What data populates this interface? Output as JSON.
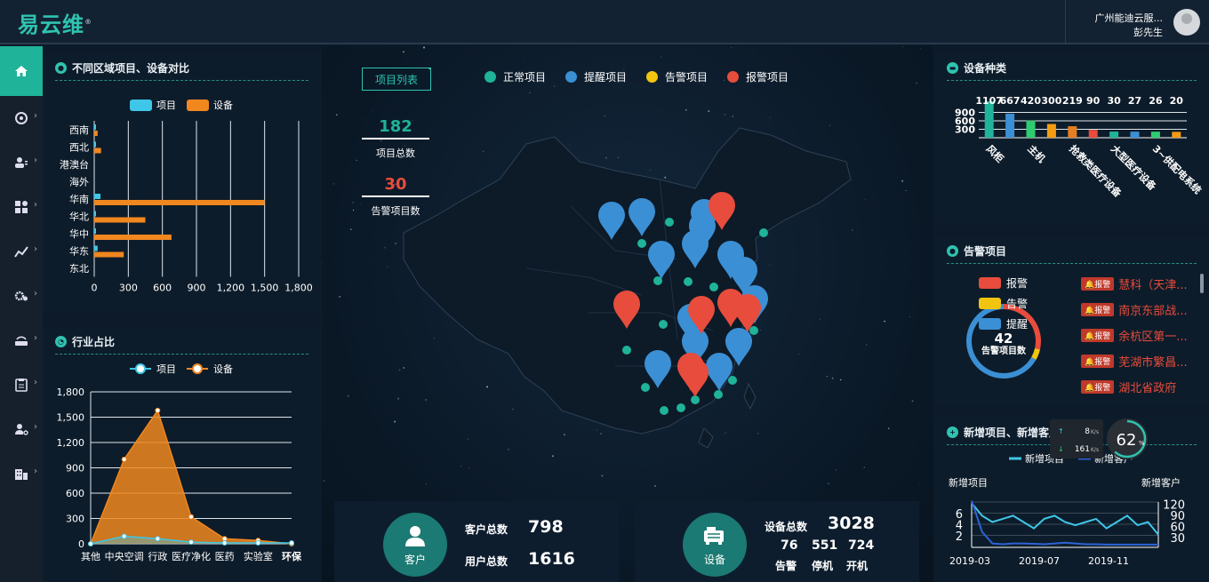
{
  "header": {
    "logo_text": "易云维",
    "logo_mark": "®",
    "company": "广州能迪云服...",
    "user": "彭先生"
  },
  "sidebar": {
    "items": [
      {
        "icon": "home-icon"
      },
      {
        "icon": "dashboard-icon"
      },
      {
        "icon": "users-icon"
      },
      {
        "icon": "grid-icon"
      },
      {
        "icon": "chart-icon"
      },
      {
        "icon": "settings-icon"
      },
      {
        "icon": "router-icon"
      },
      {
        "icon": "clipboard-icon"
      },
      {
        "icon": "user-settings-icon"
      },
      {
        "icon": "building-icon"
      }
    ]
  },
  "region_panel": {
    "title": "不同区域项目、设备对比",
    "legend": [
      "项目",
      "设备"
    ]
  },
  "industry_panel": {
    "title": "行业占比",
    "legend": [
      "项目",
      "设备"
    ]
  },
  "center": {
    "project_list_button": "项目列表",
    "legend": [
      {
        "label": "正常项目",
        "color": "#1fb39a"
      },
      {
        "label": "提醒项目",
        "color": "#3b8fd4"
      },
      {
        "label": "告警项目",
        "color": "#f1c40f"
      },
      {
        "label": "报警项目",
        "color": "#e74c3c"
      }
    ],
    "total_projects": "182",
    "total_projects_label": "项目总数",
    "alarm_projects": "30",
    "alarm_projects_label": "告警项目数"
  },
  "customer_card": {
    "icon_label": "客户",
    "customer_total_label": "客户总数",
    "customer_total": "798",
    "user_total_label": "用户总数",
    "user_total": "1616"
  },
  "device_card": {
    "icon_label": "设备",
    "device_total_label": "设备总数",
    "device_total": "3028",
    "alarm_count": "76",
    "alarm_label": "告警",
    "stopped_count": "551",
    "stopped_label": "停机",
    "running_count": "724",
    "running_label": "开机"
  },
  "device_type_panel": {
    "title": "设备种类"
  },
  "alarm_panel": {
    "title": "告警项目",
    "legend": [
      {
        "label": "报警",
        "color": "#e74c3c"
      },
      {
        "label": "告警",
        "color": "#f1c40f"
      },
      {
        "label": "提醒",
        "color": "#3b8fd4"
      }
    ],
    "center_value": "42",
    "center_label": "告警项目数",
    "badge": "报警",
    "items": [
      "慧科（天津...",
      "南京东部战...",
      "余杭区第一...",
      "芜湖市繁昌...",
      "湖北省政府"
    ]
  },
  "new_panel": {
    "title": "新增项目、新增客户",
    "legend": [
      "新增项目",
      "新增客户"
    ],
    "left_axis_title": "新增项目",
    "right_axis_title": "新增客户"
  },
  "net_widget": {
    "up": "8",
    "down": "161",
    "unit": "K/s",
    "percent": "62",
    "percent_unit": "%"
  },
  "chart_data": [
    {
      "type": "bar",
      "orientation": "horizontal",
      "categories": [
        "西南",
        "西北",
        "港澳台",
        "海外",
        "华南",
        "华北",
        "华中",
        "华东",
        "东北"
      ],
      "series": [
        {
          "name": "项目",
          "values": [
            5,
            5,
            0,
            0,
            55,
            10,
            10,
            30,
            0
          ]
        },
        {
          "name": "设备",
          "values": [
            30,
            60,
            0,
            0,
            1500,
            450,
            680,
            260,
            0
          ]
        }
      ],
      "xlim": [
        0,
        1800
      ],
      "xticks": [
        "0",
        "300",
        "600",
        "900",
        "1,200",
        "1,500",
        "1,800"
      ],
      "colors": [
        "#3ec7e8",
        "#f0871f"
      ]
    },
    {
      "type": "area",
      "categories": [
        "其他",
        "中央空调",
        "行政",
        "医疗净化",
        "医药",
        "实验室",
        "环保"
      ],
      "x_tick_labels": [
        "其他",
        "中央空调",
        "行政",
        "医疗净化",
        "医药",
        "实验室",
        "环保"
      ],
      "series": [
        {
          "name": "项目",
          "values": [
            0,
            90,
            60,
            20,
            10,
            10,
            10
          ]
        },
        {
          "name": "设备",
          "values": [
            0,
            1000,
            1580,
            320,
            60,
            40,
            0
          ]
        }
      ],
      "ylim": [
        0,
        1800
      ],
      "yticks": [
        "0",
        "300",
        "600",
        "900",
        "1,200",
        "1,500",
        "1,800"
      ],
      "colors": [
        "#3ec7e8",
        "#f0871f"
      ]
    },
    {
      "type": "bar",
      "categories": [
        "风柜",
        "",
        "主机",
        "",
        "抢救类医疗设备",
        "",
        "大型医疗设备",
        "",
        "3~供配电系统"
      ],
      "values": [
        1107,
        667,
        420,
        300,
        219,
        90,
        30,
        27,
        26,
        20
      ],
      "value_labels": [
        "1107",
        "667",
        "420",
        "300",
        "219",
        "90",
        "30",
        "27",
        "26",
        "20"
      ],
      "x_tick_labels": [
        "风柜",
        "主机",
        "抢救类医疗设备",
        "大型医疗设备",
        "3~供配电系统"
      ],
      "yticks": [
        "300",
        "600",
        "900"
      ],
      "colors": [
        "#1fb39a",
        "#3b8fd4",
        "#2ecc71",
        "#f39c12",
        "#e67e22",
        "#e74c3c"
      ]
    },
    {
      "type": "pie",
      "labels": [
        "报警",
        "告警",
        "提醒"
      ],
      "values": [
        12,
        2,
        28
      ],
      "colors": [
        "#e74c3c",
        "#f1c40f",
        "#3b8fd4"
      ]
    },
    {
      "type": "line",
      "x_tick_labels": [
        "2019-03",
        "2019-07",
        "2019-11"
      ],
      "left_yticks": [
        "2",
        "4",
        "6"
      ],
      "right_yticks": [
        "30",
        "60",
        "90",
        "120"
      ],
      "series": [
        {
          "name": "新增项目",
          "axis": "left",
          "values": [
            7,
            5,
            4,
            4.5,
            5,
            4,
            3,
            4.5,
            5,
            4,
            3.5,
            4,
            4.5,
            3,
            4,
            5,
            3.5,
            4,
            2
          ]
        },
        {
          "name": "新增客户",
          "axis": "right",
          "values": [
            120,
            40,
            10,
            8,
            10,
            10,
            9,
            8,
            10,
            12,
            10,
            8,
            8,
            7,
            7,
            7,
            7,
            7,
            7
          ]
        }
      ],
      "colors": [
        "#3ec7e8",
        "#2d63d6"
      ]
    }
  ]
}
